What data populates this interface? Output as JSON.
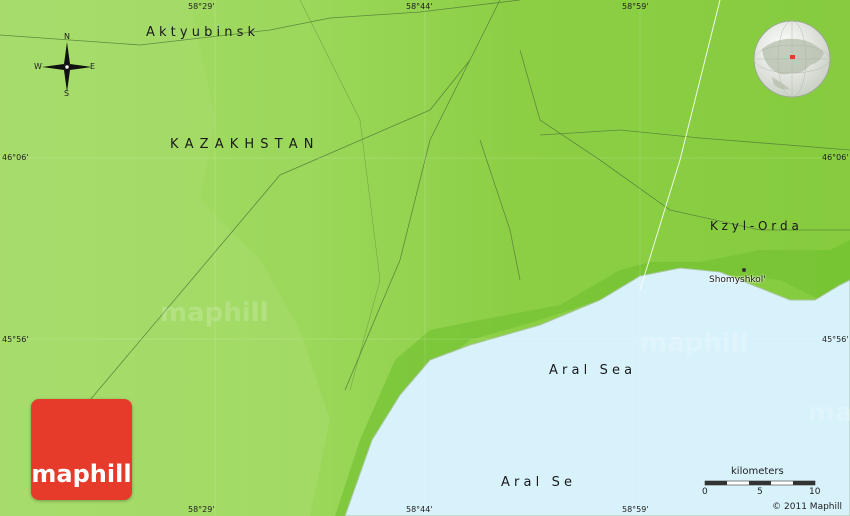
{
  "places": {
    "aktyubinsk": "A k t y u b i n s k",
    "kazakhstan": "K A Z A K H S T A N",
    "kzyl_orda": "K z y l - O r d a",
    "shomyshkol": "Shomyshkol'",
    "aral_sea_1": "A r a l   S e a",
    "aral_sea_2": "A r a l   S e"
  },
  "coords": {
    "lon1": "58°29'",
    "lon2": "58°44'",
    "lon3": "58°59'",
    "lat1": "46°06'",
    "lat2": "45°56'"
  },
  "compass": {
    "n": "N",
    "s": "S",
    "e": "E",
    "w": "W"
  },
  "scale": {
    "title": "kilometers",
    "ticks": [
      "0",
      "5",
      "10"
    ]
  },
  "branding": {
    "logo_text": "maphill",
    "watermark": "maphill",
    "copyright": "© 2011 Maphill"
  },
  "colors": {
    "land": "#8fd14a",
    "land_light": "#a8dd6e",
    "water": "#d8f2fb",
    "logo": "#e63a2b"
  }
}
